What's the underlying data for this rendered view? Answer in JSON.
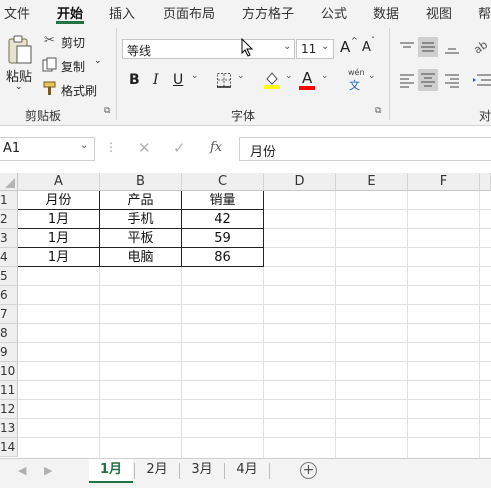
{
  "ribbon_tabs": [
    "文件",
    "开始",
    "插入",
    "页面布局",
    "方方格子",
    "公式",
    "数据",
    "视图",
    "帮"
  ],
  "clipboard": {
    "paste_label": "粘贴",
    "cut_label": "剪切",
    "copy_label": "复制",
    "format_painter_label": "格式刷",
    "group_label": "剪贴板"
  },
  "font": {
    "name": "等线",
    "size": "11",
    "grow_label": "A",
    "shrink_label": "A",
    "bold_label": "B",
    "italic_label": "I",
    "underline_label": "U",
    "font_color_label": "A",
    "phonetic_top": "wén",
    "phonetic_bottom": "文",
    "group_label": "字体",
    "highlight_color": "#ffff00",
    "font_color": "#ff0000"
  },
  "alignment": {
    "group_label": "对"
  },
  "formula_bar": {
    "name_box": "A1",
    "fx_label": "fx",
    "value": "月份"
  },
  "columns": [
    "A",
    "B",
    "C",
    "D",
    "E",
    "F"
  ],
  "rows": [
    "1",
    "2",
    "3",
    "4",
    "5",
    "6",
    "7",
    "8",
    "9",
    "10",
    "11",
    "12",
    "13",
    "14"
  ],
  "table": {
    "header": [
      "月份",
      "产品",
      "销量"
    ],
    "data": [
      [
        "1月",
        "手机",
        "42"
      ],
      [
        "1月",
        "平板",
        "59"
      ],
      [
        "1月",
        "电脑",
        "86"
      ]
    ]
  },
  "sheets": {
    "tabs": [
      "1月",
      "2月",
      "3月",
      "4月"
    ],
    "active_index": 0,
    "add_label": "+"
  },
  "colors": {
    "accent": "#217346"
  }
}
